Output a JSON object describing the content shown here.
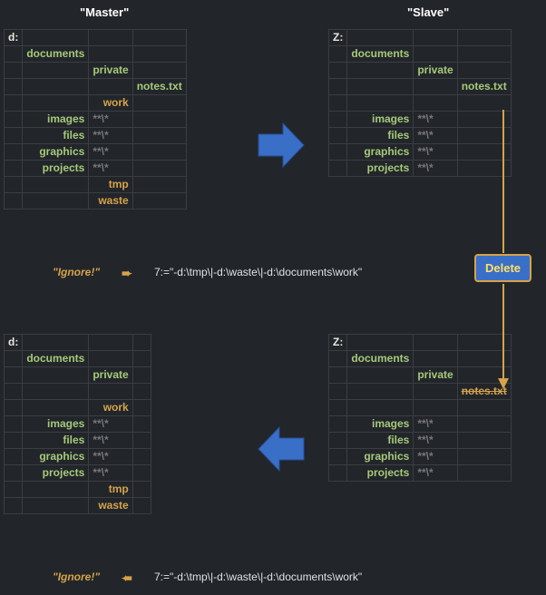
{
  "headers": {
    "master": "\"Master\"",
    "slave": "\"Slave\""
  },
  "master_top": {
    "drive": "d:",
    "folders": [
      "documents",
      "",
      "",
      "",
      "images",
      "files",
      "graphics",
      "projects",
      "",
      ""
    ],
    "subs": [
      "",
      "private",
      "",
      "work",
      "**\\*",
      "**\\*",
      "**\\*",
      "**\\*",
      "tmp",
      "waste"
    ],
    "files": [
      "",
      "",
      "notes.txt",
      "",
      "",
      "",
      "",
      "",
      "",
      ""
    ],
    "orange_rows": [
      3,
      8,
      9
    ]
  },
  "slave_top": {
    "drive": "Z:",
    "folders": [
      "documents",
      "",
      "",
      "",
      "images",
      "files",
      "graphics",
      "projects"
    ],
    "subs": [
      "",
      "private",
      "",
      "",
      "**\\*",
      "**\\*",
      "**\\*",
      "**\\*"
    ],
    "files": [
      "",
      "",
      "notes.txt",
      "",
      "",
      "",
      "",
      ""
    ],
    "orange_rows": []
  },
  "master_bot": {
    "drive": "d:",
    "folders": [
      "documents",
      "",
      "",
      "",
      "images",
      "files",
      "graphics",
      "projects",
      "",
      ""
    ],
    "subs": [
      "",
      "private",
      "",
      "work",
      "**\\*",
      "**\\*",
      "**\\*",
      "**\\*",
      "tmp",
      "waste"
    ],
    "files": [
      "",
      "",
      "",
      "",
      "",
      "",
      "",
      "",
      "",
      ""
    ],
    "orange_rows": [
      3,
      8,
      9
    ]
  },
  "slave_bot": {
    "drive": "Z:",
    "folders": [
      "documents",
      "",
      "",
      "",
      "images",
      "files",
      "graphics",
      "projects"
    ],
    "subs": [
      "",
      "private",
      "",
      "",
      "**\\*",
      "**\\*",
      "**\\*",
      "**\\*"
    ],
    "files": [
      "",
      "",
      "notes.txt",
      "",
      "",
      "",
      "",
      ""
    ],
    "orange_rows": [],
    "strike_rows": [
      2
    ]
  },
  "ignore": {
    "label": "\"Ignore!\"",
    "arrow_right": "➨",
    "arrow_left": "➨",
    "rule": "7:=\"-d:\\tmp\\|-d:\\waste\\|-d:\\documents\\work\""
  },
  "delete_label": "Delete"
}
